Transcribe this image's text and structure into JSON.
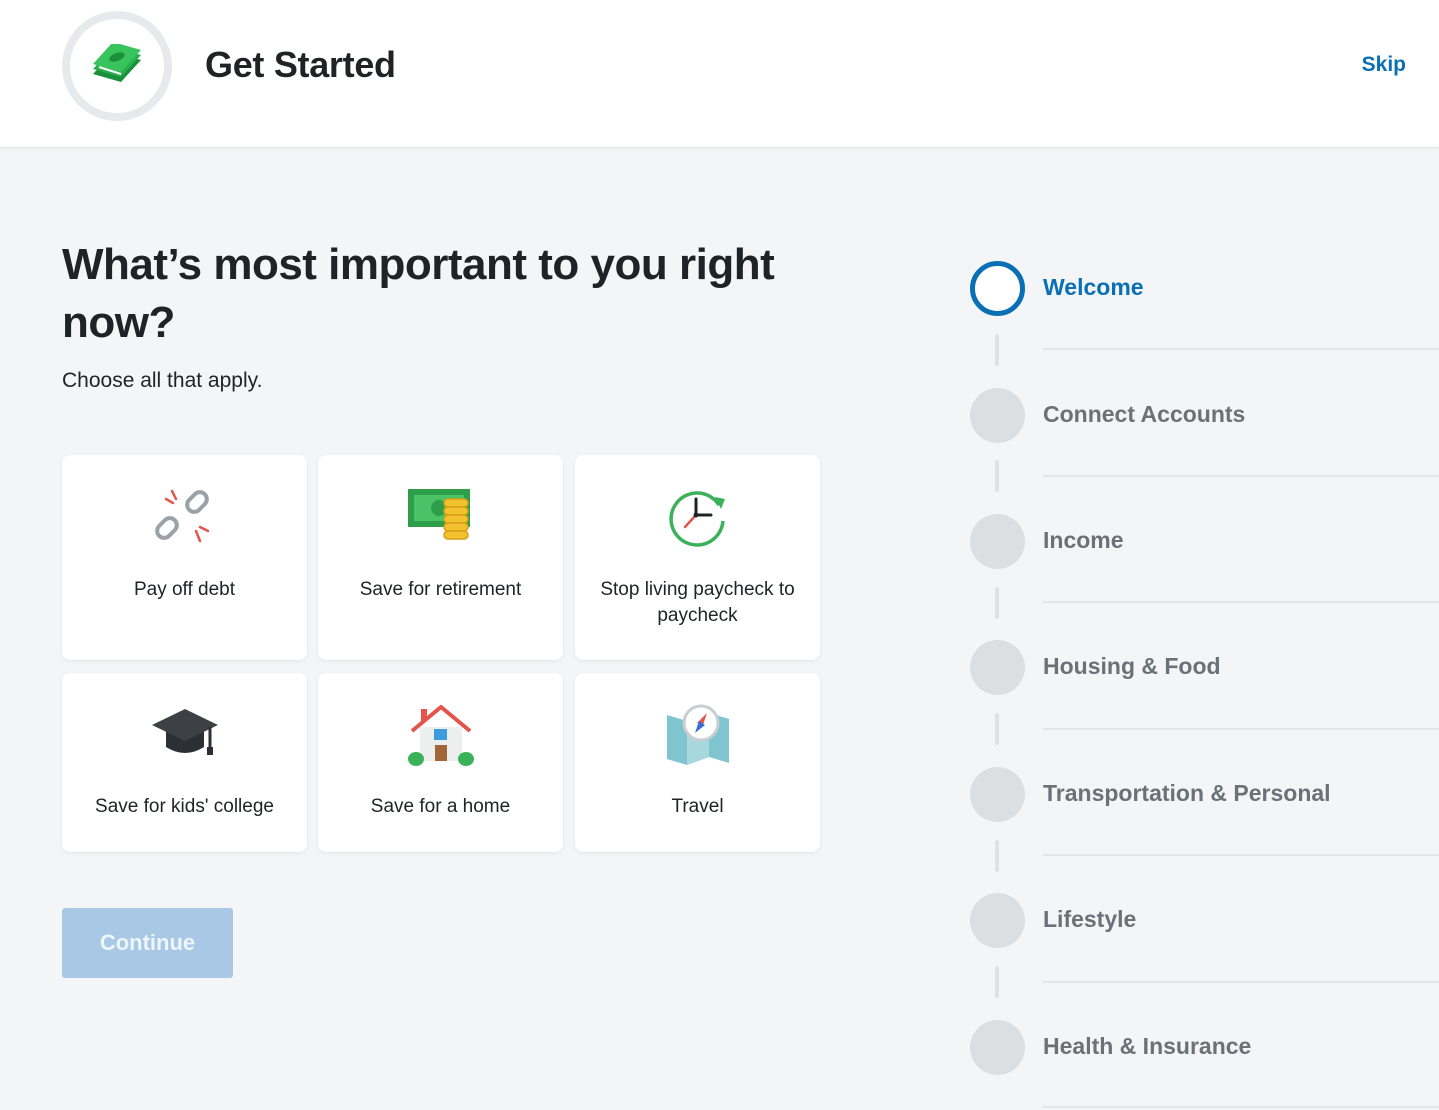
{
  "header": {
    "title": "Get Started",
    "skip_label": "Skip",
    "logo_icon": "money-stack-icon"
  },
  "main": {
    "question": "What’s most important to you right now?",
    "subtitle": "Choose all that apply.",
    "options": [
      {
        "label": "Pay off debt",
        "icon": "broken-chain-icon"
      },
      {
        "label": "Save for retirement",
        "icon": "cash-coins-icon"
      },
      {
        "label": "Stop living paycheck to paycheck",
        "icon": "clock-refresh-icon"
      },
      {
        "label": "Save for kids' college",
        "icon": "graduation-cap-icon"
      },
      {
        "label": "Save for a home",
        "icon": "house-icon"
      },
      {
        "label": "Travel",
        "icon": "map-compass-icon"
      }
    ],
    "continue_label": "Continue"
  },
  "steps": [
    {
      "label": "Welcome",
      "active": true
    },
    {
      "label": "Connect Accounts",
      "active": false
    },
    {
      "label": "Income",
      "active": false
    },
    {
      "label": "Housing & Food",
      "active": false
    },
    {
      "label": "Transportation & Personal",
      "active": false
    },
    {
      "label": "Lifestyle",
      "active": false
    },
    {
      "label": "Health & Insurance",
      "active": false
    }
  ],
  "colors": {
    "accent": "#0a6fb5",
    "continue_disabled": "#a8c8e6",
    "step_inactive": "#dcdfe2",
    "background": "#f4f5f7"
  }
}
